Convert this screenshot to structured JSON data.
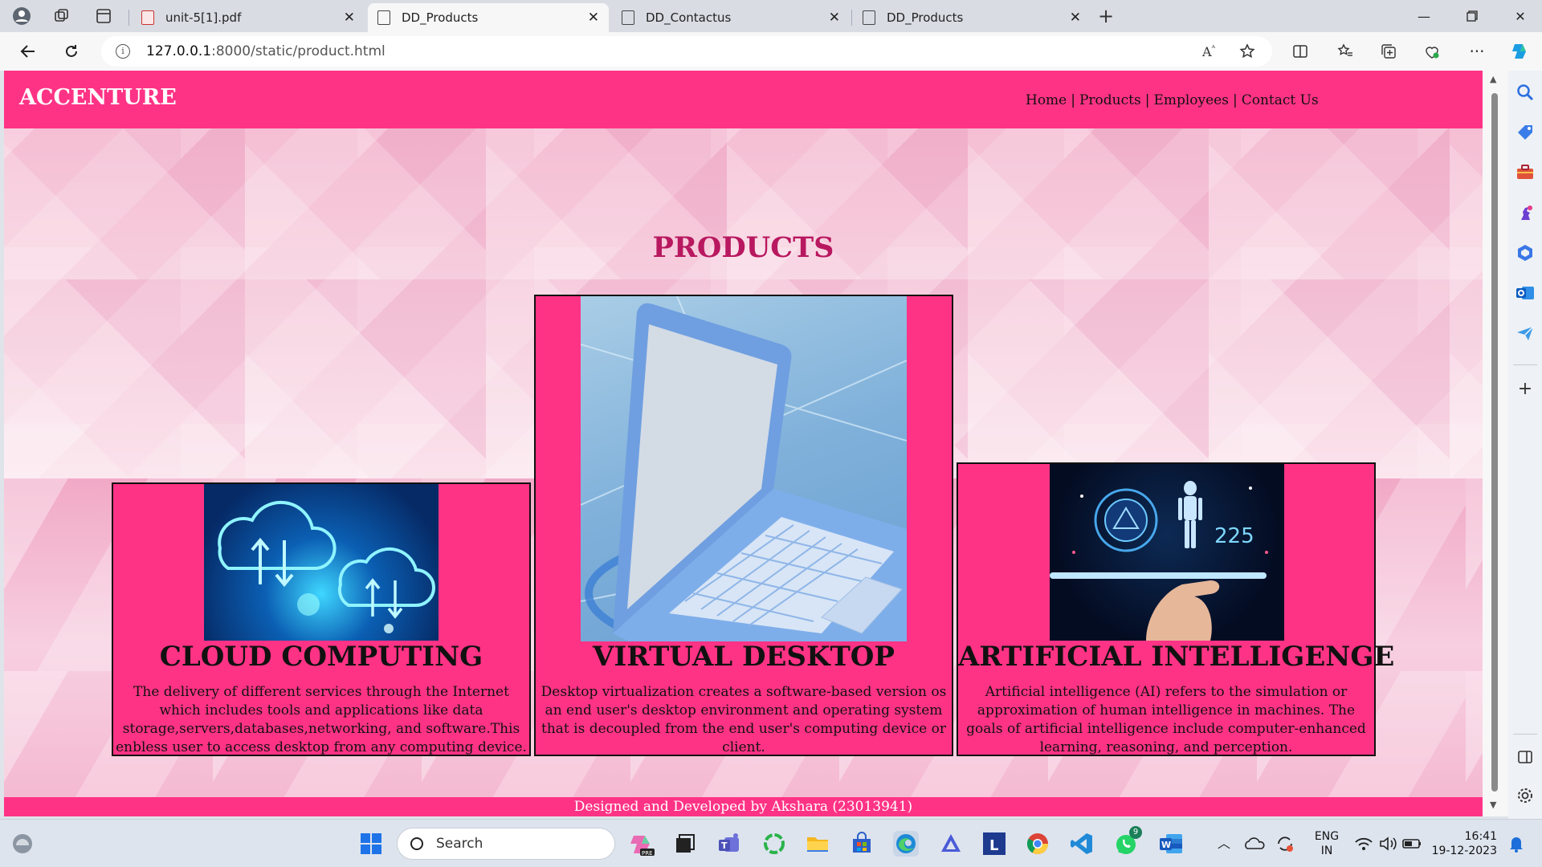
{
  "browser": {
    "tabs": [
      {
        "title": "unit-5[1].pdf",
        "icon": "pdf-icon",
        "active": false
      },
      {
        "title": "DD_Products",
        "icon": "page-icon",
        "active": true
      },
      {
        "title": "DD_Contactus",
        "icon": "page-icon",
        "active": false
      },
      {
        "title": "DD_Products",
        "icon": "page-icon",
        "active": false
      }
    ],
    "url_host": "127.0.0.1",
    "url_path": ":8000/static/product.html"
  },
  "site": {
    "brand": "ACCENTURE",
    "nav": [
      "Home",
      "Products",
      "Employees",
      "Contact Us"
    ],
    "nav_separator": "|",
    "page_title": "PRODUCTS",
    "cards": [
      {
        "title": "CLOUD COMPUTING",
        "image": "cloud-upload-download-image",
        "description": "The delivery of different services through the Internet which includes tools and applications like data storage,servers,databases,networking, and software.This enbless user to access desktop from any computing device."
      },
      {
        "title": "VIRTUAL DESKTOP",
        "image": "laptop-image",
        "description": "Desktop virtualization creates a software-based version os an end user's desktop environment and operating system that is decoupled from the end user's computing device or client."
      },
      {
        "title": "ARTIFICIAL INTELLIGENGE",
        "image": "ai-robot-hand-image",
        "description": "Artificial intelligence (AI) refers to the simulation or approximation of human intelligence in machines. The goals of artificial intelligence include computer-enhanced learning, reasoning, and perception."
      }
    ],
    "footer": "Designed and Developed by Akshara (23013941)",
    "colors": {
      "primary_pink": "#ff3385",
      "title_pink": "#b8185f"
    }
  },
  "taskbar": {
    "search_placeholder": "Search",
    "whatsapp_badge": "9",
    "language": "ENG",
    "region": "IN",
    "time": "16:41",
    "date": "19-12-2023"
  }
}
